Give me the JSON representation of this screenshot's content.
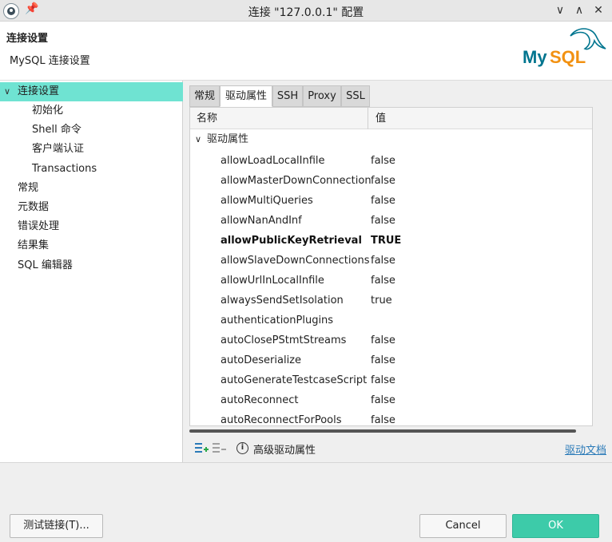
{
  "window": {
    "title": "连接 \"127.0.0.1\" 配置",
    "minimize_glyph": "∨",
    "maximize_glyph": "∧",
    "close_glyph": "✕"
  },
  "header": {
    "title": "连接设置",
    "subtitle": "MySQL 连接设置",
    "logo_text": "MySQL",
    "logo_colors": {
      "my": "#00758f",
      "sql": "#f29111"
    }
  },
  "sidebar": {
    "items": [
      {
        "label": "连接设置",
        "level": 0,
        "expanded": true,
        "selected": true
      },
      {
        "label": "初始化",
        "level": 1
      },
      {
        "label": "Shell 命令",
        "level": 1
      },
      {
        "label": "客户端认证",
        "level": 1
      },
      {
        "label": "Transactions",
        "level": 1
      },
      {
        "label": "常规",
        "level": 0
      },
      {
        "label": "元数据",
        "level": 0
      },
      {
        "label": "错误处理",
        "level": 0
      },
      {
        "label": "结果集",
        "level": 0
      },
      {
        "label": "SQL 编辑器",
        "level": 0
      }
    ],
    "selected_color": "#6fe3d2"
  },
  "tabs": [
    {
      "label": "常规",
      "active": false
    },
    {
      "label": "驱动属性",
      "active": true
    },
    {
      "label": "SSH",
      "active": false
    },
    {
      "label": "Proxy",
      "active": false
    },
    {
      "label": "SSL",
      "active": false
    }
  ],
  "table": {
    "columns": [
      "名称",
      "值"
    ],
    "group": "驱动属性",
    "rows": [
      {
        "name": "allowLoadLocalInfile",
        "value": "false"
      },
      {
        "name": "allowMasterDownConnection",
        "value": "false"
      },
      {
        "name": "allowMultiQueries",
        "value": "false"
      },
      {
        "name": "allowNanAndInf",
        "value": "false"
      },
      {
        "name": "allowPublicKeyRetrieval",
        "value": "TRUE",
        "bold": true
      },
      {
        "name": "allowSlaveDownConnections",
        "value": "false"
      },
      {
        "name": "allowUrlInLocalInfile",
        "value": "false"
      },
      {
        "name": "alwaysSendSetIsolation",
        "value": "true"
      },
      {
        "name": "authenticationPlugins",
        "value": ""
      },
      {
        "name": "autoClosePStmtStreams",
        "value": "false"
      },
      {
        "name": "autoDeserialize",
        "value": "false"
      },
      {
        "name": "autoGenerateTestcaseScript",
        "value": "false"
      },
      {
        "name": "autoReconnect",
        "value": "false"
      },
      {
        "name": "autoReconnectForPools",
        "value": "false"
      }
    ]
  },
  "bottom": {
    "advanced_label": "高级驱动属性",
    "doc_link": "驱动文档",
    "icons": [
      "add-property-icon",
      "remove-property-icon",
      "info-icon"
    ]
  },
  "footer": {
    "test_button": "测试链接(T)...",
    "cancel_button": "Cancel",
    "ok_button": "OK",
    "ok_color": "#3dcba9"
  }
}
